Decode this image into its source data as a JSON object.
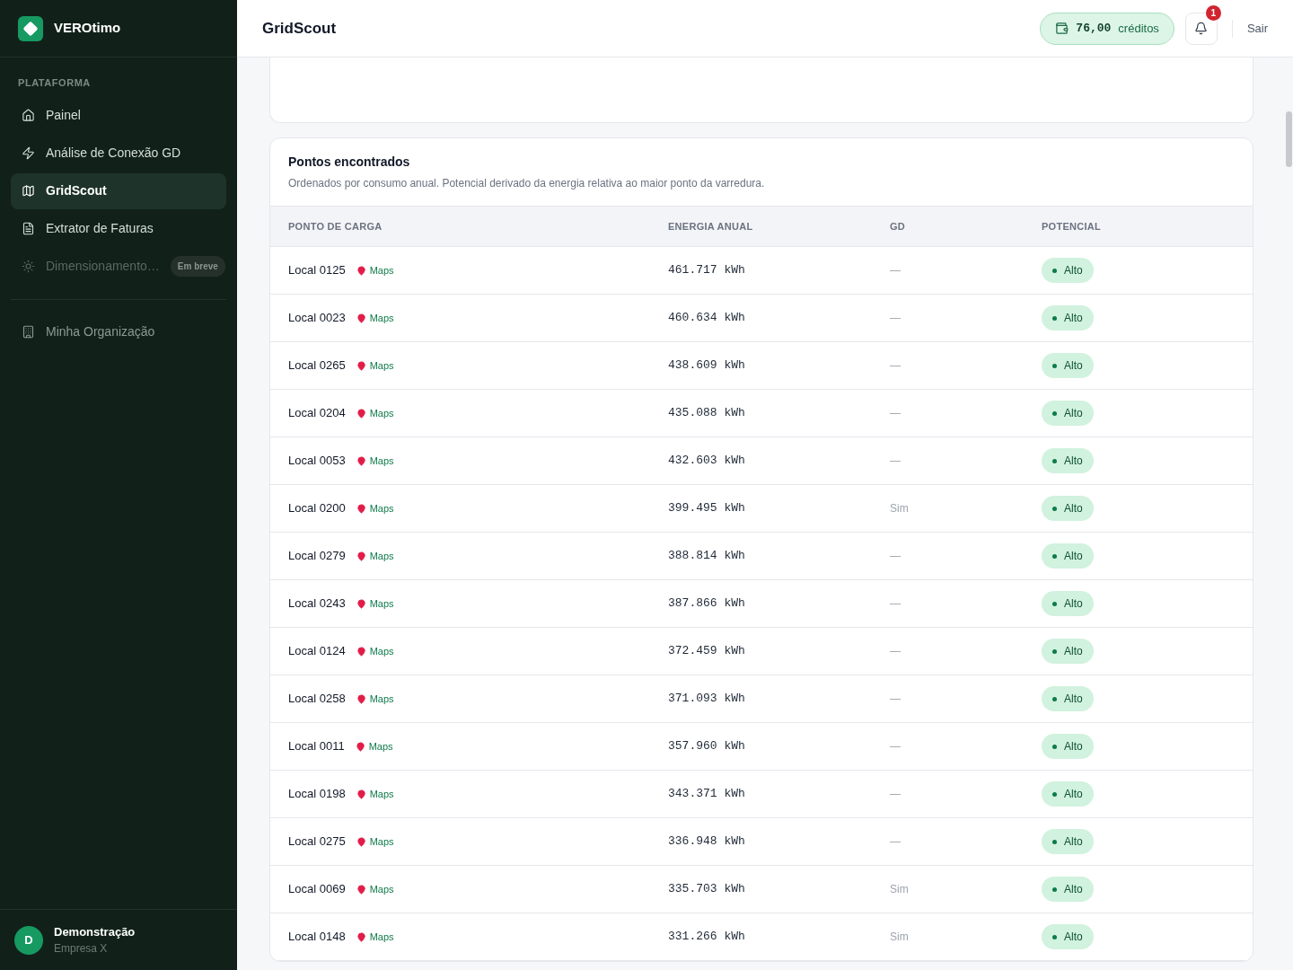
{
  "brand": {
    "name": "VEROtimo"
  },
  "sidebar": {
    "section": "PLATAFORMA",
    "items": [
      {
        "label": "Painel",
        "selected": false,
        "disabled": false
      },
      {
        "label": "Análise de Conexão GD",
        "selected": false,
        "disabled": false
      },
      {
        "label": "GridScout",
        "selected": true,
        "disabled": false
      },
      {
        "label": "Extrator de Faturas",
        "selected": false,
        "disabled": false
      },
      {
        "label": "Dimensionamento…",
        "selected": false,
        "disabled": true,
        "badge": "Em breve"
      }
    ],
    "org_items": [
      {
        "label": "Minha Organização",
        "selected": false
      }
    ],
    "user": {
      "initial": "D",
      "name": "Demonstração",
      "company": "Empresa X"
    }
  },
  "header": {
    "title": "GridScout",
    "credits": {
      "amount": "76,00",
      "unit": "créditos"
    },
    "notifications": "1",
    "logout": "Sair"
  },
  "results": {
    "title": "Pontos encontrados",
    "subtitle": "Ordenados por consumo anual. Potencial derivado da energia relativa ao maior ponto da varredura.",
    "columns": [
      "PONTO DE CARGA",
      "ENERGIA ANUAL",
      "GD",
      "POTENCIAL"
    ],
    "rows": [
      {
        "name": "Local 0125",
        "link": "Maps",
        "energy": "461.717 kWh",
        "gd": "—",
        "potential": "Alto"
      },
      {
        "name": "Local 0023",
        "link": "Maps",
        "energy": "460.634 kWh",
        "gd": "—",
        "potential": "Alto"
      },
      {
        "name": "Local 0265",
        "link": "Maps",
        "energy": "438.609 kWh",
        "gd": "—",
        "potential": "Alto"
      },
      {
        "name": "Local 0204",
        "link": "Maps",
        "energy": "435.088 kWh",
        "gd": "—",
        "potential": "Alto"
      },
      {
        "name": "Local 0053",
        "link": "Maps",
        "energy": "432.603 kWh",
        "gd": "—",
        "potential": "Alto"
      },
      {
        "name": "Local 0200",
        "link": "Maps",
        "energy": "399.495 kWh",
        "gd": "Sim",
        "potential": "Alto"
      },
      {
        "name": "Local 0279",
        "link": "Maps",
        "energy": "388.814 kWh",
        "gd": "—",
        "potential": "Alto"
      },
      {
        "name": "Local 0243",
        "link": "Maps",
        "energy": "387.866 kWh",
        "gd": "—",
        "potential": "Alto"
      },
      {
        "name": "Local 0124",
        "link": "Maps",
        "energy": "372.459 kWh",
        "gd": "—",
        "potential": "Alto"
      },
      {
        "name": "Local 0258",
        "link": "Maps",
        "energy": "371.093 kWh",
        "gd": "—",
        "potential": "Alto"
      },
      {
        "name": "Local 0011",
        "link": "Maps",
        "energy": "357.960 kWh",
        "gd": "—",
        "potential": "Alto"
      },
      {
        "name": "Local 0198",
        "link": "Maps",
        "energy": "343.371 kWh",
        "gd": "—",
        "potential": "Alto"
      },
      {
        "name": "Local 0275",
        "link": "Maps",
        "energy": "336.948 kWh",
        "gd": "—",
        "potential": "Alto"
      },
      {
        "name": "Local 0069",
        "link": "Maps",
        "energy": "335.703 kWh",
        "gd": "Sim",
        "potential": "Alto"
      },
      {
        "name": "Local 0148",
        "link": "Maps",
        "energy": "331.266 kWh",
        "gd": "Sim",
        "potential": "Alto"
      }
    ]
  }
}
